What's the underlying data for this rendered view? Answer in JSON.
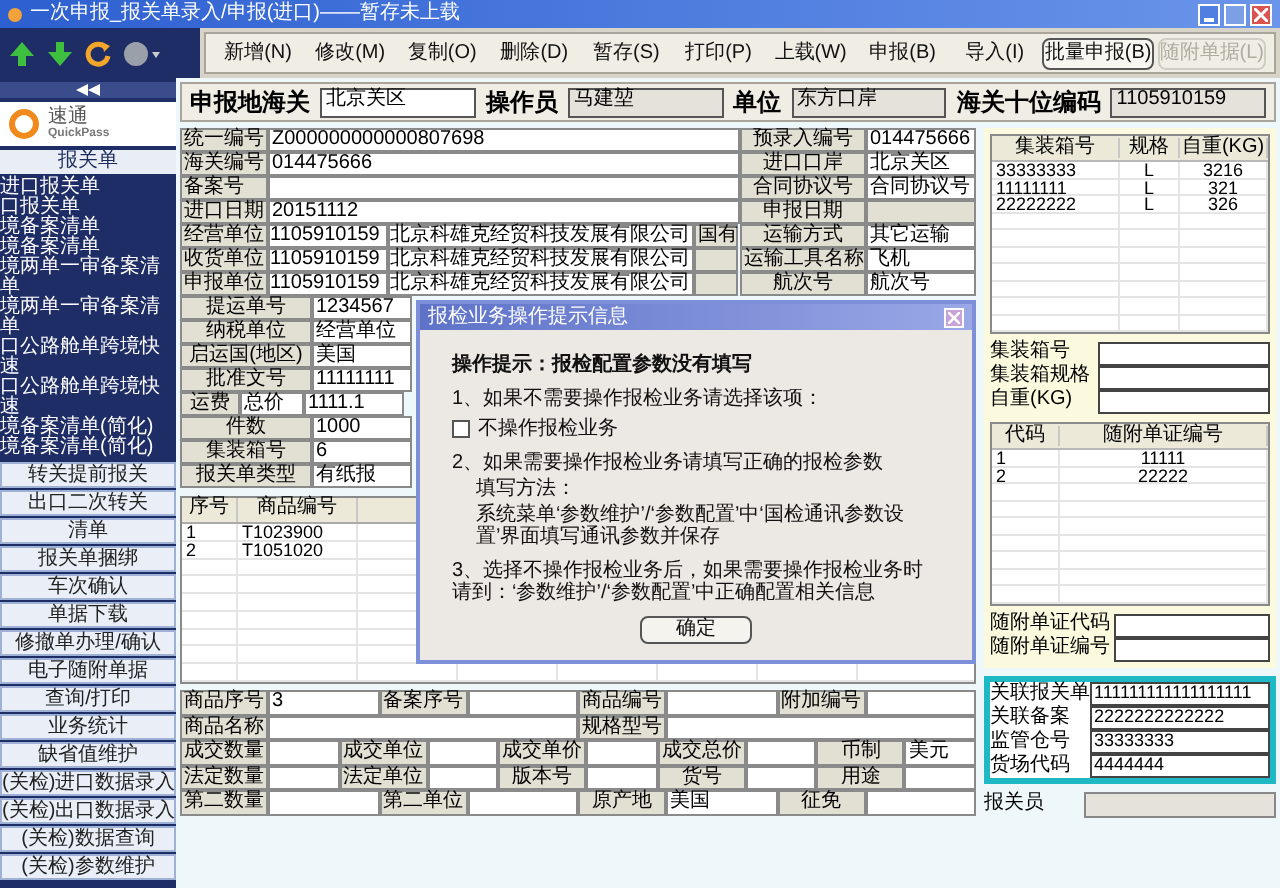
{
  "window": {
    "title": "一次申报_报关单录入/申报(进口)——暂存未上载"
  },
  "toolbar": [
    {
      "label": "新增(N)",
      "disabled": false,
      "focused": false
    },
    {
      "label": "修改(M)",
      "disabled": false,
      "focused": false
    },
    {
      "label": "复制(O)",
      "disabled": false,
      "focused": false
    },
    {
      "label": "删除(D)",
      "disabled": false,
      "focused": false
    },
    {
      "label": "暂存(S)",
      "disabled": false,
      "focused": false
    },
    {
      "label": "打印(P)",
      "disabled": false,
      "focused": false
    },
    {
      "label": "上载(W)",
      "disabled": false,
      "focused": false
    },
    {
      "label": "申报(B)",
      "disabled": false,
      "focused": false
    },
    {
      "label": "导入(I)",
      "disabled": false,
      "focused": false
    },
    {
      "label": "批量申报(B)",
      "disabled": false,
      "focused": true
    },
    {
      "label": "随附单据(L)",
      "disabled": true,
      "focused": false
    }
  ],
  "sidebar": {
    "logo": {
      "name": "速通",
      "sub": "QuickPass"
    },
    "section": "报关单",
    "items": [
      "进口报关单",
      "口报关单",
      "境备案清单",
      "境备案清单",
      "境两单一审备案清单",
      "境两单一审备案清单",
      "口公路舱单跨境快速",
      "口公路舱单跨境快速",
      "境备案清单(简化)",
      "境备案清单(简化)"
    ],
    "buttons": [
      "转关提前报关",
      "出口二次转关",
      "清单",
      "报关单捆绑",
      "车次确认",
      "单据下载",
      "修撤单办理/确认",
      "电子随附单据",
      "查询/打印",
      "业务统计",
      "缺省值维护",
      "(关检)进口数据录入",
      "(关检)出口数据录入",
      "(关检)数据查询",
      "(关检)参数维护"
    ]
  },
  "header": [
    {
      "label": "申报地海关",
      "value": "北京关区"
    },
    {
      "label": "操作员",
      "value": "马建堃"
    },
    {
      "label": "单位",
      "value": "东方口岸"
    },
    {
      "label": "海关十位编码",
      "value": "1105910159"
    }
  ],
  "form": {
    "top_rows": [
      {
        "cells": [
          {
            "kind": "label",
            "text": "统一编号"
          },
          {
            "kind": "value",
            "text": "Z000000000000807698"
          }
        ],
        "right": {
          "label": "预录入编号",
          "value": "014475666"
        }
      },
      {
        "cells": [
          {
            "kind": "label",
            "text": "海关编号"
          },
          {
            "kind": "value",
            "text": "014475666"
          }
        ],
        "right": {
          "label": "进口口岸",
          "value": "北京关区"
        }
      },
      {
        "cells": [
          {
            "kind": "label",
            "text": "备案号"
          },
          {
            "kind": "value"
          }
        ],
        "right": {
          "label": "合同协议号",
          "value": "合同协议号"
        }
      },
      {
        "cells": [
          {
            "kind": "label",
            "text": "进口日期"
          },
          {
            "kind": "value",
            "text": "20151112"
          }
        ],
        "right": {
          "label": "申报日期"
        }
      },
      {
        "cells": [
          {
            "kind": "label",
            "text": "经营单位"
          },
          {
            "kind": "code",
            "text": "1105910159"
          },
          {
            "kind": "name",
            "text": "北京科雄克经贸科技发展有限公司"
          },
          {
            "kind": "tag",
            "text": "国有"
          }
        ],
        "right": {
          "label": "运输方式",
          "value": "其它运输"
        }
      },
      {
        "cells": [
          {
            "kind": "label",
            "text": "收货单位"
          },
          {
            "kind": "code",
            "text": "1105910159"
          },
          {
            "kind": "name",
            "text": "北京科雄克经贸科技发展有限公司"
          },
          {
            "kind": "tag"
          }
        ],
        "right": {
          "label": "运输工具名称",
          "value": "飞机"
        }
      },
      {
        "cells": [
          {
            "kind": "label",
            "text": "申报单位"
          },
          {
            "kind": "code",
            "text": "1105910159"
          },
          {
            "kind": "name",
            "text": "北京科雄克经贸科技发展有限公司"
          },
          {
            "kind": "tag"
          }
        ],
        "right": {
          "label": "航次号",
          "value": "航次号"
        }
      }
    ],
    "lower_rows": [
      {
        "label": "提运单号",
        "value": "1234567"
      },
      {
        "label": "纳税单位",
        "value": "经营单位"
      },
      {
        "label": "启运国(地区)",
        "value": "美国"
      },
      {
        "label": "批准文号",
        "value": "11111111"
      },
      {
        "label": "运费",
        "sub": "总价",
        "value": "1111.1"
      },
      {
        "label": "件数",
        "value": "1000"
      },
      {
        "label": "集装箱号",
        "value": "6"
      },
      {
        "label": "报关单类型",
        "value": "有纸报"
      }
    ]
  },
  "goods": {
    "columns": [
      "序号",
      "商品编号"
    ],
    "rows": [
      [
        "1",
        "T1023900"
      ],
      [
        "2",
        "T1051020"
      ]
    ]
  },
  "goods_detail": [
    [
      {
        "label": "商品序号",
        "value": "3"
      },
      {
        "label": "备案序号"
      },
      {
        "label": "商品编号"
      },
      {
        "label": "附加编号"
      }
    ],
    [
      {
        "label": "商品名称"
      },
      {
        "label": "规格型号"
      }
    ],
    [
      {
        "label": "成交数量"
      },
      {
        "label": "成交单位"
      },
      {
        "label": "成交单价"
      },
      {
        "label": "成交总价"
      },
      {
        "label": "币制",
        "value": "美元"
      }
    ],
    [
      {
        "label": "法定数量"
      },
      {
        "label": "法定单位"
      },
      {
        "label": "版本号"
      },
      {
        "label": "货号"
      },
      {
        "label": "用途"
      }
    ],
    [
      {
        "label": "第二数量"
      },
      {
        "label": "第二单位"
      },
      {
        "label": "原产地",
        "value": "美国"
      },
      {
        "label": "征免"
      }
    ]
  ],
  "containers": {
    "columns": [
      "集装箱号",
      "规格",
      "自重(KG)"
    ],
    "rows": [
      [
        "33333333",
        "L",
        "3216"
      ],
      [
        "11111111",
        "L",
        "321"
      ],
      [
        "22222222",
        "L",
        "326"
      ]
    ]
  },
  "container_fields": [
    "集装箱号",
    "集装箱规格",
    "自重(KG)"
  ],
  "documents": {
    "columns": [
      "代码",
      "随附单证编号"
    ],
    "rows": [
      [
        "1",
        "11111"
      ],
      [
        "2",
        "22222"
      ]
    ]
  },
  "document_fields": [
    "随附单证代码",
    "随附单证编号"
  ],
  "related": [
    {
      "label": "关联报关单",
      "value": "111111111111111111"
    },
    {
      "label": "关联备案",
      "value": "2222222222222"
    },
    {
      "label": "监管仓号",
      "value": "33333333"
    },
    {
      "label": "货场代码",
      "value": "4444444"
    }
  ],
  "bottom_fields": [
    "报关员"
  ],
  "dialog": {
    "title": "报检业务操作提示信息",
    "heading": "操作提示：报检配置参数没有填写",
    "items": [
      {
        "kind": "check",
        "text": "1、如果不需要操作报检业务请选择该项：",
        "option": "不操作报检业务",
        "checked": false
      },
      {
        "kind": "text",
        "text": "2、如果需要操作报检业务请填写正确的报检参数",
        "note_title": "填写方法：",
        "note": "系统菜单‘参数维护’/‘参数配置’中‘国检通讯参数设置’界面填写通讯参数并保存"
      },
      {
        "kind": "text",
        "text": "3、选择不操作报检业务后，如果需要操作报检业务时请到：‘参数维护’/‘参数配置’中正确配置相关信息"
      }
    ],
    "button": "确定"
  }
}
